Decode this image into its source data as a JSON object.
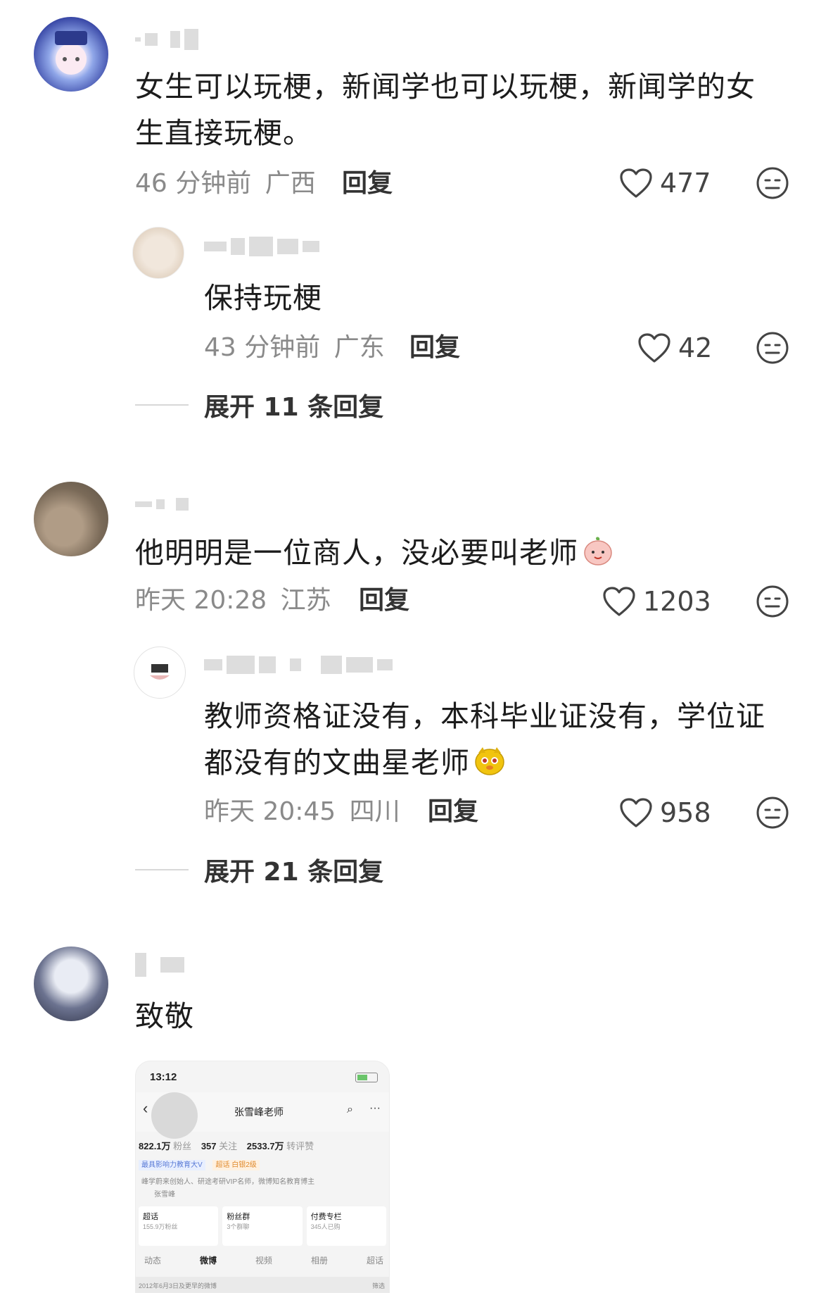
{
  "comments": [
    {
      "text": "女生可以玩梗，新闻学也可以玩梗，新闻学的女生直接玩梗。",
      "time": "46 分钟前",
      "location": "广西",
      "reply_label": "回复",
      "likes": "477",
      "subreply": {
        "text": "保持玩梗",
        "time": "43 分钟前",
        "location": "广东",
        "reply_label": "回复",
        "likes": "42"
      },
      "expand_label": "展开 11 条回复"
    },
    {
      "text": "他明明是一位商人，没必要叫老师",
      "time": "昨天 20:28",
      "location": "江苏",
      "reply_label": "回复",
      "likes": "1203",
      "subreply": {
        "text": "教师资格证没有，本科毕业证没有，学位证都没有的文曲星老师",
        "time": "昨天 20:45",
        "location": "四川",
        "reply_label": "回复",
        "likes": "958"
      },
      "expand_label": "展开 21 条回复"
    },
    {
      "text": "致敬",
      "screenshot": {
        "time": "13:12",
        "name": "张雪峰老师",
        "fans": "822.1万",
        "fans_label": "粉丝",
        "follow": "357",
        "follow_label": "关注",
        "reposts": "2533.7万",
        "reposts_label": "转评赞",
        "badge1": "最具影响力教育大V",
        "badge2": "超话 白银2级",
        "bio": "峰学蔚来创始人、研途考研VIP名师，微博知名教育博主",
        "bio2": "张雪峰",
        "card1_title": "超话",
        "card1_sub": "155.9万粉丝",
        "card2_title": "粉丝群",
        "card2_sub": "3个群聊",
        "card3_title": "付费专栏",
        "card3_sub": "345人已购",
        "tabs": [
          "动态",
          "微博",
          "视频",
          "相册",
          "超话"
        ],
        "footer": "2012年6月3日及更早的微博",
        "footer_right": "筛选"
      }
    }
  ],
  "colors": {
    "meta": "#8a8a8a",
    "text": "#1c1c1c",
    "divider": "#d8d8d8"
  }
}
